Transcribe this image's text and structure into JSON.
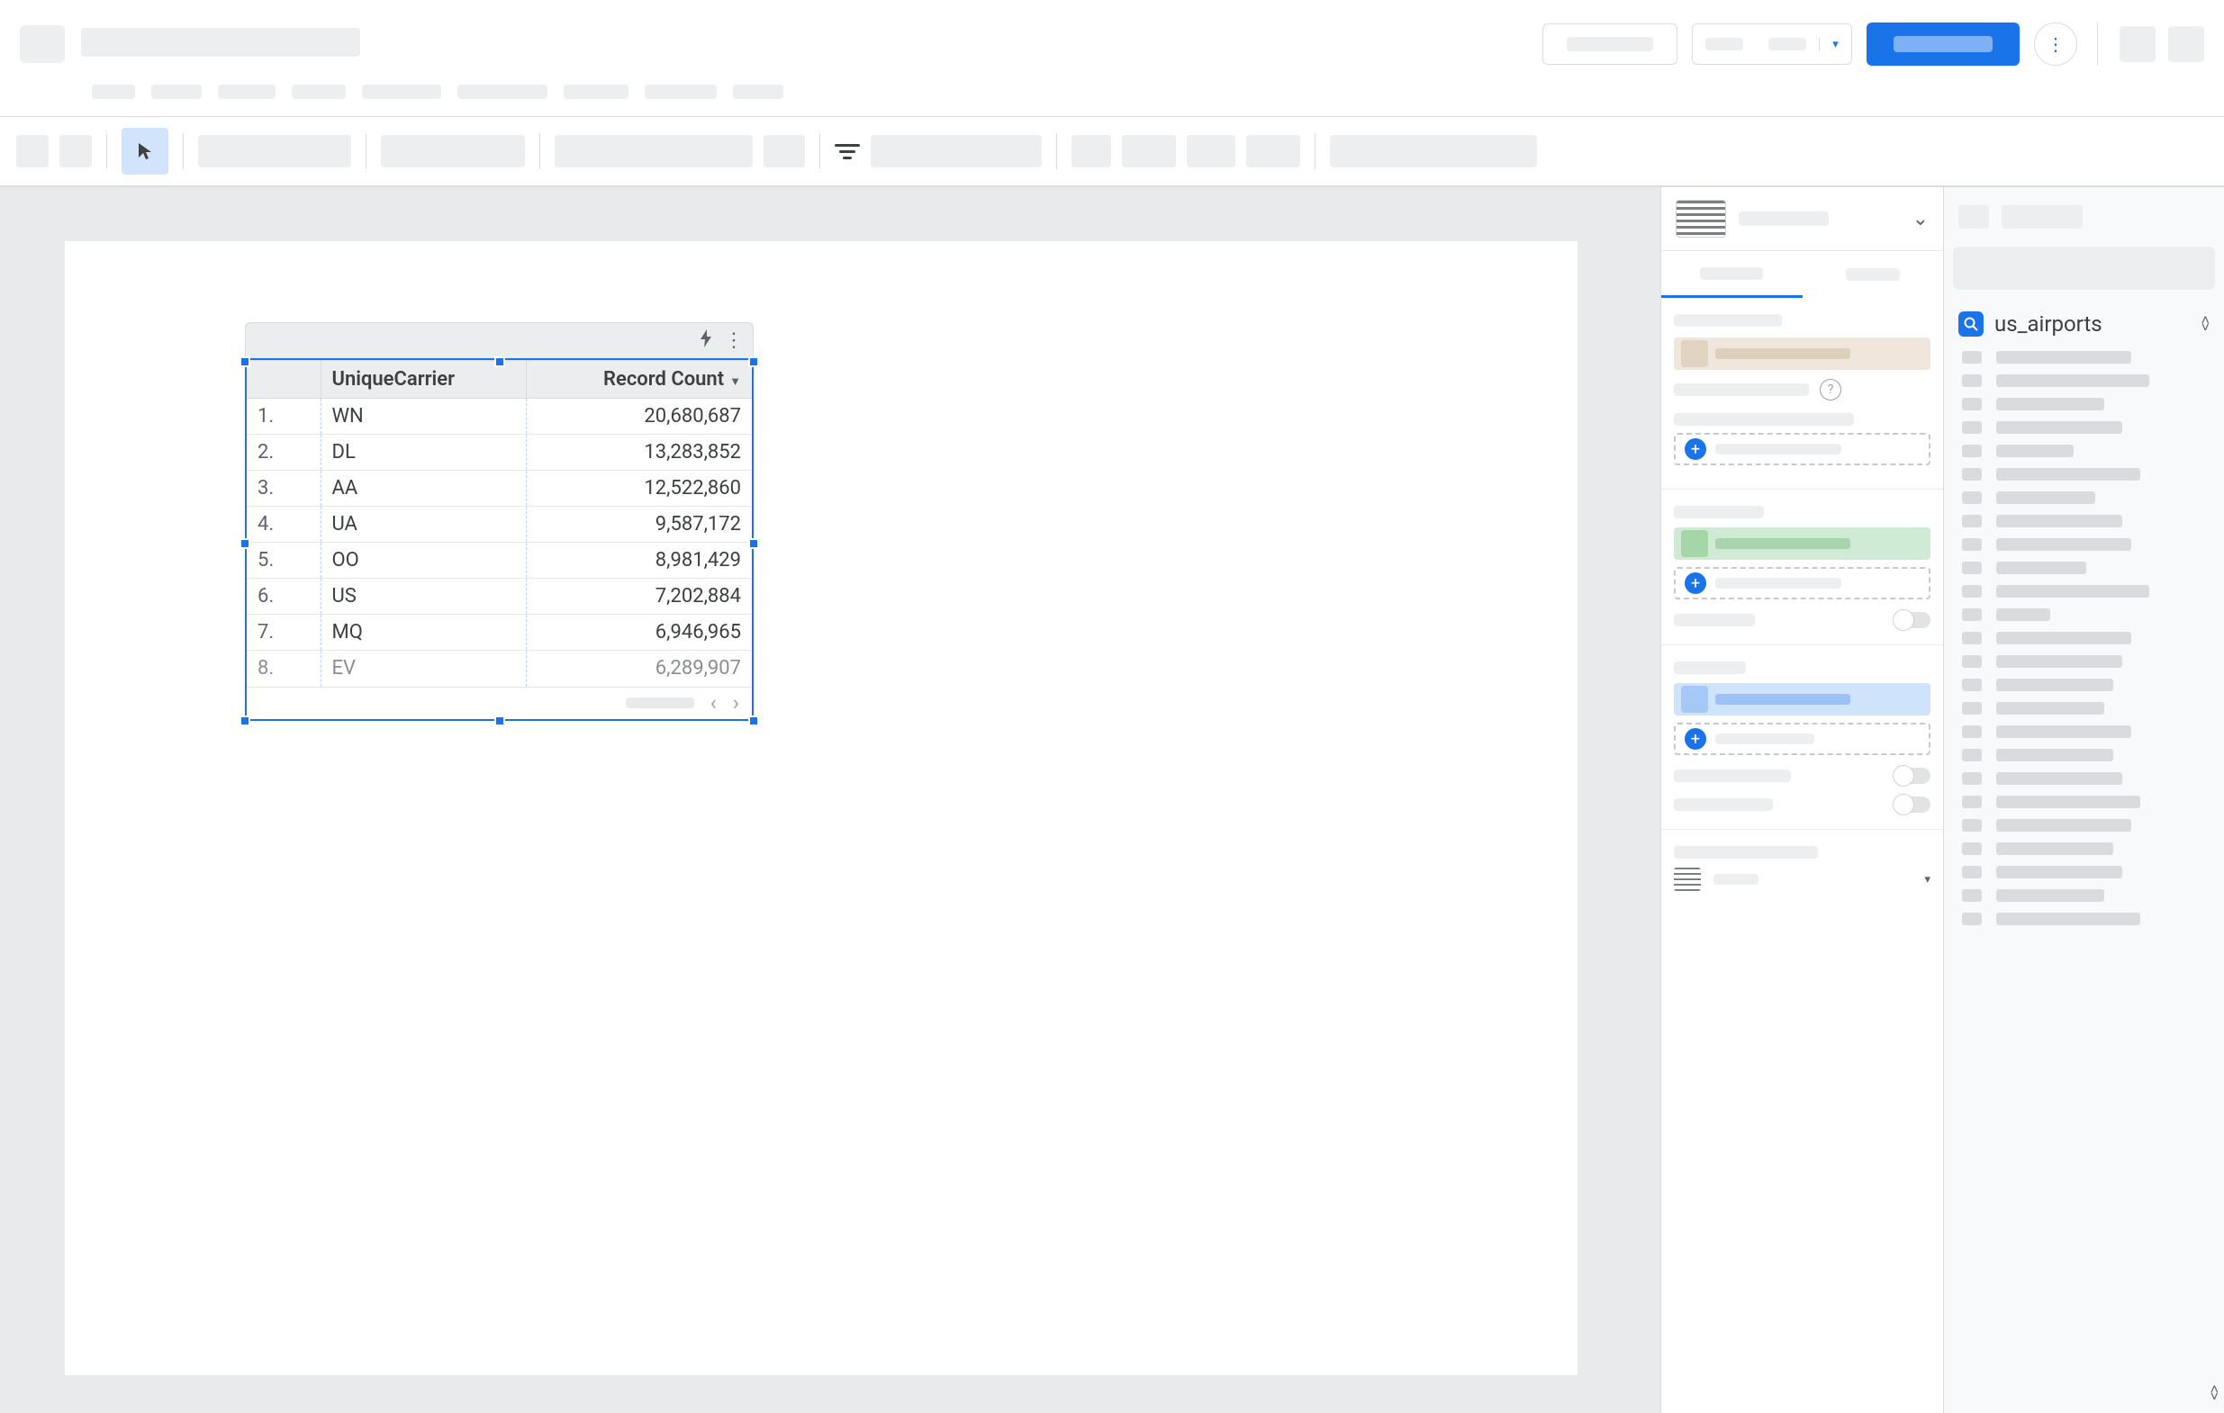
{
  "header": {
    "overflow_icon": "⋮",
    "split_caret": "▾"
  },
  "toolbar": {
    "cursor_glyph": "↖"
  },
  "chart": {
    "lightning": "⚡",
    "kebab": "⋮",
    "columns": {
      "index": "",
      "dimension": "UniqueCarrier",
      "metric": "Record Count",
      "sort_direction": "desc"
    },
    "rows": [
      {
        "idx": "1.",
        "carrier": "WN",
        "count": "20,680,687"
      },
      {
        "idx": "2.",
        "carrier": "DL",
        "count": "13,283,852"
      },
      {
        "idx": "3.",
        "carrier": "AA",
        "count": "12,522,860"
      },
      {
        "idx": "4.",
        "carrier": "UA",
        "count": "9,587,172"
      },
      {
        "idx": "5.",
        "carrier": "OO",
        "count": "8,981,429"
      },
      {
        "idx": "6.",
        "carrier": "US",
        "count": "7,202,884"
      },
      {
        "idx": "7.",
        "carrier": "MQ",
        "count": "6,946,965"
      },
      {
        "idx": "8.",
        "carrier": "EV",
        "count": "6,289,907"
      }
    ],
    "pager": {
      "prev": "‹",
      "next": "›"
    }
  },
  "chart_data": {
    "type": "table",
    "columns": [
      "UniqueCarrier",
      "Record Count"
    ],
    "rows": [
      [
        "WN",
        20680687
      ],
      [
        "DL",
        13283852
      ],
      [
        "AA",
        12522860
      ],
      [
        "UA",
        9587172
      ],
      [
        "OO",
        8981429
      ],
      [
        "US",
        7202884
      ],
      [
        "MQ",
        6946965
      ],
      [
        "EV",
        6289907
      ]
    ],
    "sort": {
      "column": "Record Count",
      "order": "desc"
    }
  },
  "properties": {
    "tab_chevron": "⌄",
    "add": "+",
    "help": "?",
    "dropdown_caret": "▾"
  },
  "data_panel": {
    "datasource_name": "us_airports",
    "lens_glyph": "🔍",
    "expand_up": "˄",
    "expand_down": "˅"
  }
}
